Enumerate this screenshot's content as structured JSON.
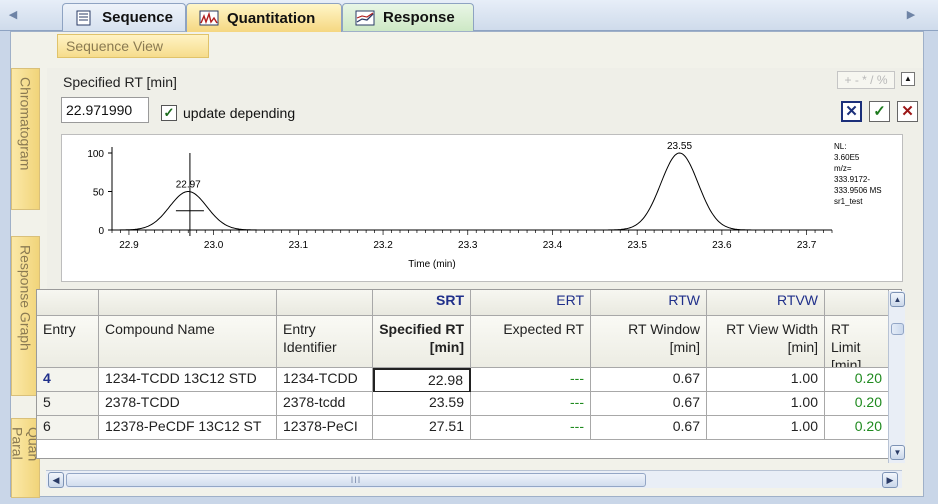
{
  "tabs": {
    "sequence": "Sequence",
    "quantitation": "Quantitation",
    "response": "Response"
  },
  "sequence_view": "Sequence View",
  "side_tabs": {
    "chromatogram": "Chromatogram",
    "response_graph": "Response Graph",
    "quan_params": "Quan Paral"
  },
  "specified_rt": {
    "label": "Specified RT [min]",
    "value": "22.971990",
    "update_checked": true,
    "update_label": "update depending",
    "format_buttons": "+ - * / %"
  },
  "chromatogram": {
    "y_ticks": [
      "100",
      "50",
      "0"
    ],
    "x_ticks": [
      "22.9",
      "23.0",
      "23.1",
      "23.2",
      "23.3",
      "23.4",
      "23.5",
      "23.6",
      "23.7"
    ],
    "xlabel": "Time (min)",
    "peaks": [
      {
        "label": "22.97",
        "rt": 22.97,
        "height": 50
      },
      {
        "label": "23.55",
        "rt": 23.55,
        "height": 100
      }
    ],
    "info": [
      "NL:",
      "3.60E5",
      "m/z=",
      "333.9172-",
      "333.9506 MS",
      "sr1_test"
    ]
  },
  "table": {
    "top_headers": {
      "srt": "SRT",
      "ert": "ERT",
      "rtw": "RTW",
      "rtvw": "RTVW"
    },
    "headers": {
      "entry": "Entry",
      "compound": "Compound Name",
      "entry_id": "Entry Identifier",
      "specified_rt": "Specified RT [min]",
      "expected_rt": "Expected RT",
      "rt_window": "RT Window [min]",
      "rt_view_width": "RT View Width [min]",
      "rt_limit": "RT Limit [min]"
    },
    "rows": [
      {
        "entry": "4",
        "compound": "1234-TCDD 13C12 STD",
        "id": "1234-TCDD",
        "srt": "22.98",
        "ert": "---",
        "rtw": "0.67",
        "rtvw": "1.00",
        "limit": "0.20"
      },
      {
        "entry": "5",
        "compound": "2378-TCDD",
        "id": "2378-tcdd",
        "srt": "23.59",
        "ert": "---",
        "rtw": "0.67",
        "rtvw": "1.00",
        "limit": "0.20"
      },
      {
        "entry": "6",
        "compound": "12378-PeCDF 13C12 ST",
        "id": "12378-PeCI",
        "srt": "27.51",
        "ert": "---",
        "rtw": "0.67",
        "rtvw": "1.00",
        "limit": "0.20"
      }
    ]
  },
  "hscroll_grip": "III"
}
